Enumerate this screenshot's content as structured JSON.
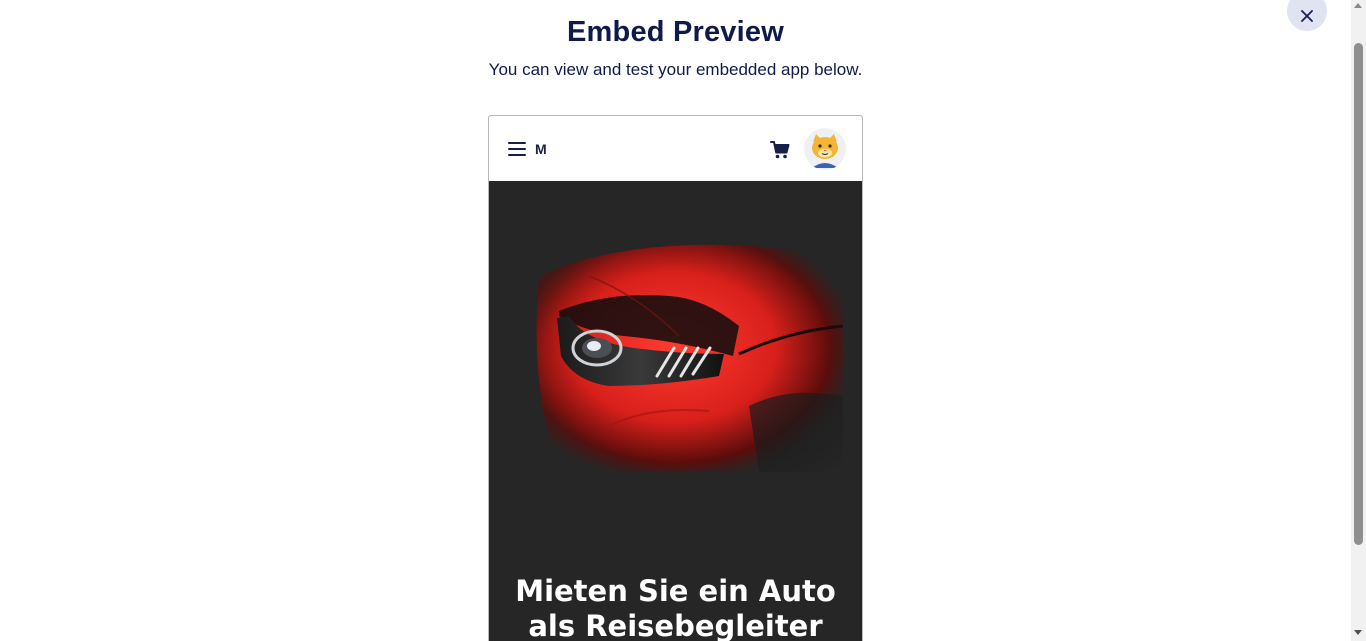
{
  "modal": {
    "title": "Embed Preview",
    "subtitle": "You can view and test your embedded app below.",
    "close_icon": "close-icon",
    "close_button_bg": "#dfe3f2"
  },
  "embedded_app": {
    "header": {
      "menu_icon": "hamburger-menu-icon",
      "brand": "M",
      "cart_icon": "shopping-cart-icon",
      "avatar_icon": "cat-avatar-icon"
    },
    "hero": {
      "image": "red-sports-car-headlight-image",
      "title": "Mieten Sie ein Auto als Reisebegleiter",
      "background": "#262626"
    }
  },
  "colors": {
    "title_text": "#0f1a4a",
    "accent_red": "#e52421"
  }
}
